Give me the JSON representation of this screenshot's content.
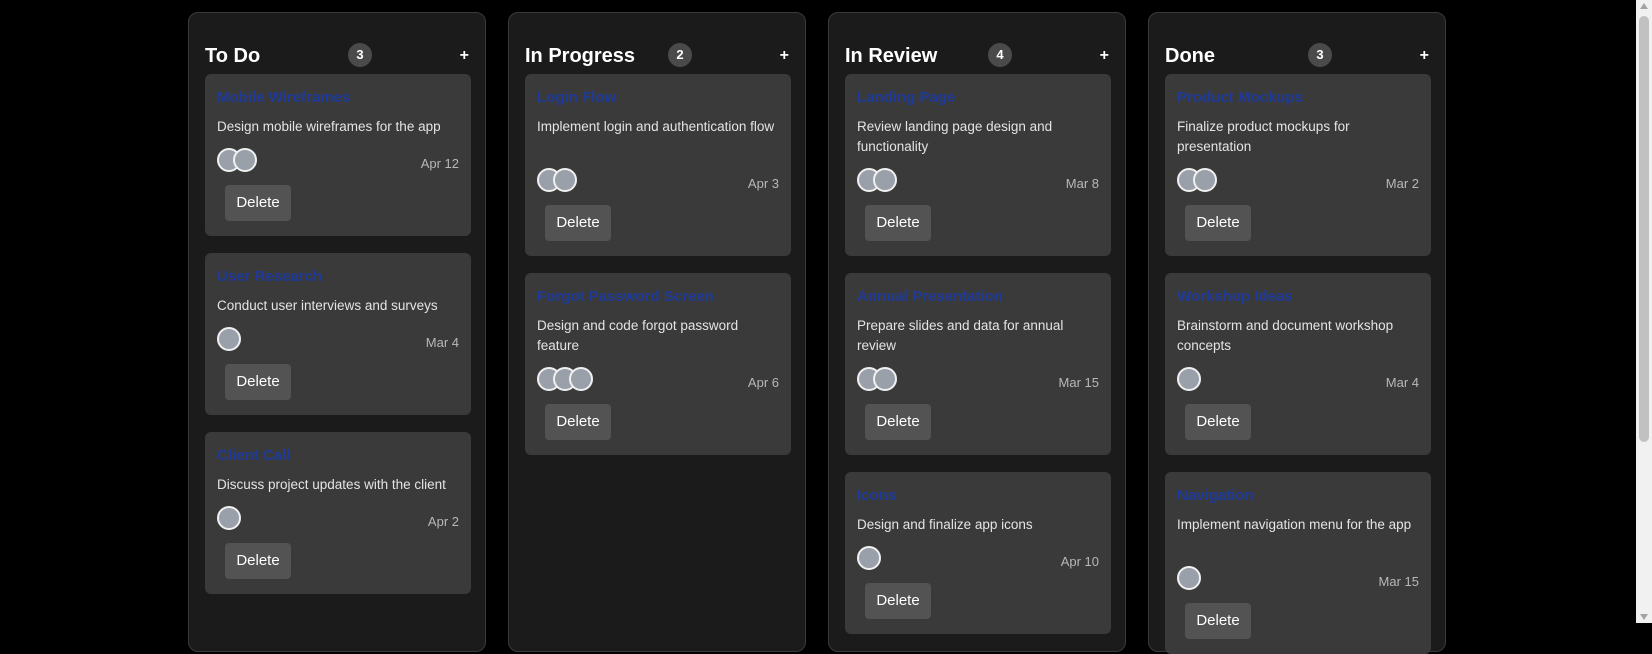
{
  "colors": {
    "background": "#000000",
    "column": "#1b1b1b",
    "card": "#3a3a3a",
    "title_link": "#1e3a9a",
    "button": "#535353"
  },
  "columns": [
    {
      "title": "To Do",
      "count": "3",
      "add_label": "+",
      "cards": [
        {
          "title": "Mobile Wireframes",
          "description": "Design mobile wireframes for the app",
          "date": "Apr 12",
          "avatar_count": 2,
          "delete_label": "Delete"
        },
        {
          "title": "User Research",
          "description": "Conduct user interviews and surveys",
          "date": "Mar 4",
          "avatar_count": 1,
          "delete_label": "Delete"
        },
        {
          "title": "Client Call",
          "description": "Discuss project updates with the client",
          "date": "Apr 2",
          "avatar_count": 1,
          "delete_label": "Delete"
        }
      ]
    },
    {
      "title": "In Progress",
      "count": "2",
      "add_label": "+",
      "cards": [
        {
          "title": "Login Flow",
          "description": "Implement login and authentication flow",
          "date": "Apr 3",
          "avatar_count": 2,
          "delete_label": "Delete"
        },
        {
          "title": "Forgot Password Screen",
          "description": "Design and code forgot password feature",
          "date": "Apr 6",
          "avatar_count": 3,
          "delete_label": "Delete"
        }
      ]
    },
    {
      "title": "In Review",
      "count": "4",
      "add_label": "+",
      "cards": [
        {
          "title": "Landing Page",
          "description": "Review landing page design and functionality",
          "date": "Mar 8",
          "avatar_count": 2,
          "delete_label": "Delete"
        },
        {
          "title": "Annual Presentation",
          "description": "Prepare slides and data for annual review",
          "date": "Mar 15",
          "avatar_count": 2,
          "delete_label": "Delete"
        },
        {
          "title": "Icons",
          "description": "Design and finalize app icons",
          "date": "Apr 10",
          "avatar_count": 1,
          "delete_label": "Delete"
        }
      ]
    },
    {
      "title": "Done",
      "count": "3",
      "add_label": "+",
      "cards": [
        {
          "title": "Product Mockups",
          "description": "Finalize product mockups for presentation",
          "date": "Mar 2",
          "avatar_count": 2,
          "delete_label": "Delete"
        },
        {
          "title": "Workshop Ideas",
          "description": "Brainstorm and document workshop concepts",
          "date": "Mar 4",
          "avatar_count": 1,
          "delete_label": "Delete"
        },
        {
          "title": "Navigation",
          "description": "Implement navigation menu for the app",
          "date": "Mar 15",
          "avatar_count": 1,
          "delete_label": "Delete"
        }
      ]
    }
  ]
}
